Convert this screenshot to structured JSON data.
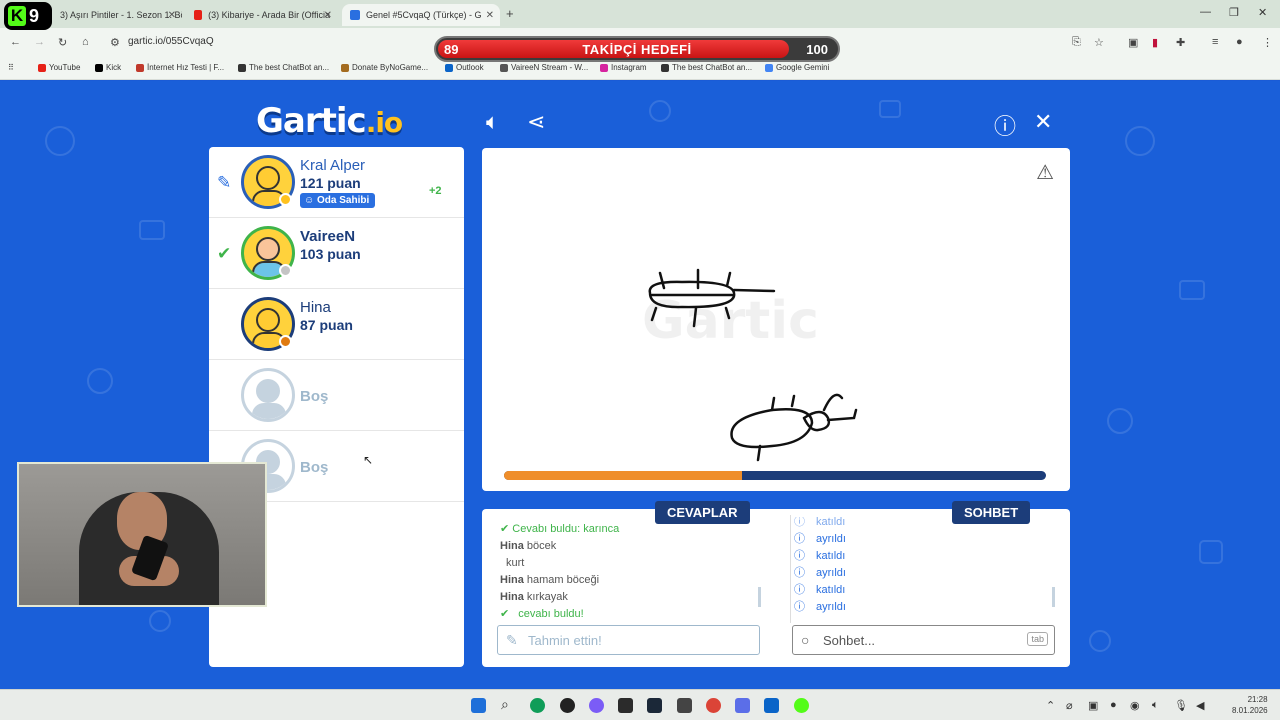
{
  "browser": {
    "tabs": [
      {
        "label": "3) Aşırı Pintiler - 1. Sezon 1. Bö",
        "active": false
      },
      {
        "label": "(3) Kibariye - Arada Bir (Officia",
        "active": false
      },
      {
        "label": "Genel #5CvqaQ (Türkçe) - G",
        "active": true
      }
    ],
    "url": "gartic.io/055CvqaQ",
    "bookmarks": [
      "YouTube",
      "Kick",
      "İnternet Hız Testi | F...",
      "The best ChatBot an...",
      "Donate ByNoGame...",
      "Outlook",
      "VaireeN Stream - W...",
      "Instagram",
      "The best ChatBot an...",
      "Google Gemini"
    ],
    "channel_badge": {
      "letter": "K",
      "number": "9"
    }
  },
  "goal": {
    "label": "TAKİPÇİ HEDEFİ",
    "current": "89",
    "target": "100",
    "progress": 0.89
  },
  "game": {
    "logo": "Gartic",
    "logo_suffix": ".io",
    "players": [
      {
        "name": "Kral Alper",
        "score": "121 puan",
        "owner_label": "Oda Sahibi",
        "bonus": "+2",
        "status_color": "#ffc21f",
        "indicator": "pencil-icon"
      },
      {
        "name": "VaireeN",
        "score": "103 puan",
        "status_color": "#c4c4c4",
        "indicator": "check-icon"
      },
      {
        "name": "Hina",
        "score": "87 puan",
        "status_color": "#e07a10"
      },
      {
        "name": "Boş"
      },
      {
        "name": "Boş"
      }
    ],
    "timer_progress": 0.44,
    "answers_tab": "CEVAPLAR",
    "chat_tab": "SOHBET",
    "answers": [
      {
        "user": "",
        "text": "Cevabı buldu: karınca",
        "type": "found"
      },
      {
        "user": "Hina",
        "text": "böcek"
      },
      {
        "user": "",
        "text": "kurt"
      },
      {
        "user": "Hina",
        "text": "hamam böceği"
      },
      {
        "user": "Hina",
        "text": "kırkayak"
      },
      {
        "user": "",
        "text": "cevabı buldu!",
        "type": "found"
      }
    ],
    "chat": [
      {
        "text": "katıldı",
        "partial": true
      },
      {
        "text": "ayrıldı"
      },
      {
        "text": "katıldı"
      },
      {
        "text": "ayrıldı"
      },
      {
        "text": "katıldı"
      },
      {
        "text": "ayrıldı"
      }
    ],
    "guess_placeholder": "Tahmin ettin!",
    "chat_placeholder": "Sohbet...",
    "chat_key_hint": "tab"
  },
  "taskbar": {
    "time": "21:28",
    "date": "8.01.2026"
  }
}
